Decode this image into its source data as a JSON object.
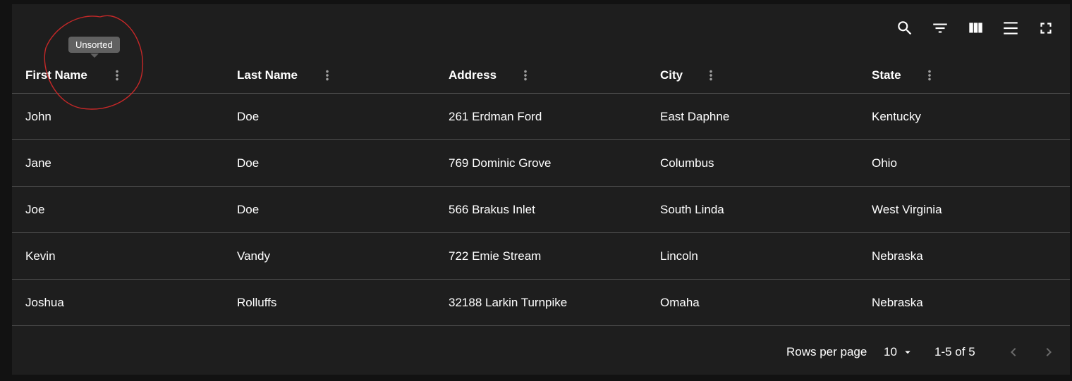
{
  "toolbar": {
    "icons": [
      "search-icon",
      "filter-list-icon",
      "view-column-icon",
      "density-icon",
      "fullscreen-icon"
    ]
  },
  "tooltip": {
    "text": "Unsorted"
  },
  "table": {
    "columns": [
      "First Name",
      "Last Name",
      "Address",
      "City",
      "State"
    ],
    "rows": [
      [
        "John",
        "Doe",
        "261 Erdman Ford",
        "East Daphne",
        "Kentucky"
      ],
      [
        "Jane",
        "Doe",
        "769 Dominic Grove",
        "Columbus",
        "Ohio"
      ],
      [
        "Joe",
        "Doe",
        "566 Brakus Inlet",
        "South Linda",
        "West Virginia"
      ],
      [
        "Kevin",
        "Vandy",
        "722 Emie Stream",
        "Lincoln",
        "Nebraska"
      ],
      [
        "Joshua",
        "Rolluffs",
        "32188 Larkin Turnpike",
        "Omaha",
        "Nebraska"
      ]
    ]
  },
  "pagination": {
    "rows_per_page_label": "Rows per page",
    "rows_per_page_value": "10",
    "range_text": "1-5 of 5"
  },
  "colors": {
    "background": "#121212",
    "surface": "#1e1e1e",
    "divider": "#515151",
    "annotation": "#c62828",
    "tooltip": "#616161"
  }
}
